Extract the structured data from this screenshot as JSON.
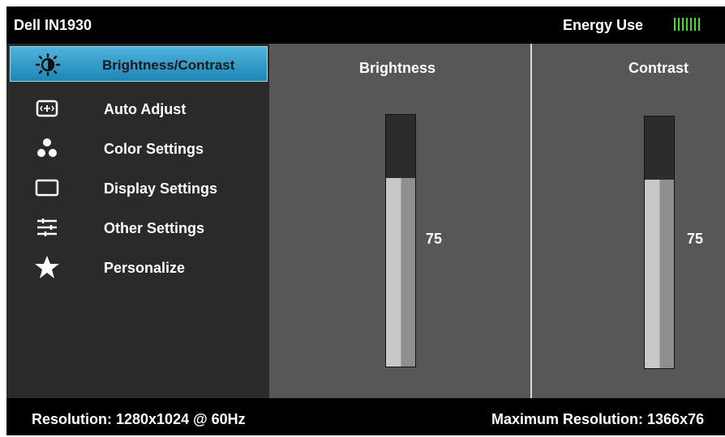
{
  "header": {
    "model": "Dell IN1930",
    "energy_label": "Energy Use",
    "energy_bars": 7
  },
  "menu": {
    "items": [
      {
        "label": "Brightness/Contrast",
        "icon": "brightness-icon",
        "selected": true
      },
      {
        "label": "Auto Adjust",
        "icon": "auto-adjust-icon",
        "selected": false
      },
      {
        "label": "Color Settings",
        "icon": "color-settings-icon",
        "selected": false
      },
      {
        "label": "Display Settings",
        "icon": "display-settings-icon",
        "selected": false
      },
      {
        "label": "Other Settings",
        "icon": "other-settings-icon",
        "selected": false
      },
      {
        "label": "Personalize",
        "icon": "star-icon",
        "selected": false
      }
    ]
  },
  "brightness": {
    "title": "Brightness",
    "value": "75",
    "level": 0.75
  },
  "contrast": {
    "title": "Contrast",
    "value": "75",
    "level": 0.75
  },
  "footer": {
    "resolution": "Resolution: 1280x1024 @ 60Hz",
    "max_resolution": "Maximum Resolution: 1366x76"
  },
  "colors": {
    "accent": "#2e9ccc",
    "energy": "#44dd22",
    "panel": "#575757",
    "sidebar": "#2a2a2a"
  }
}
